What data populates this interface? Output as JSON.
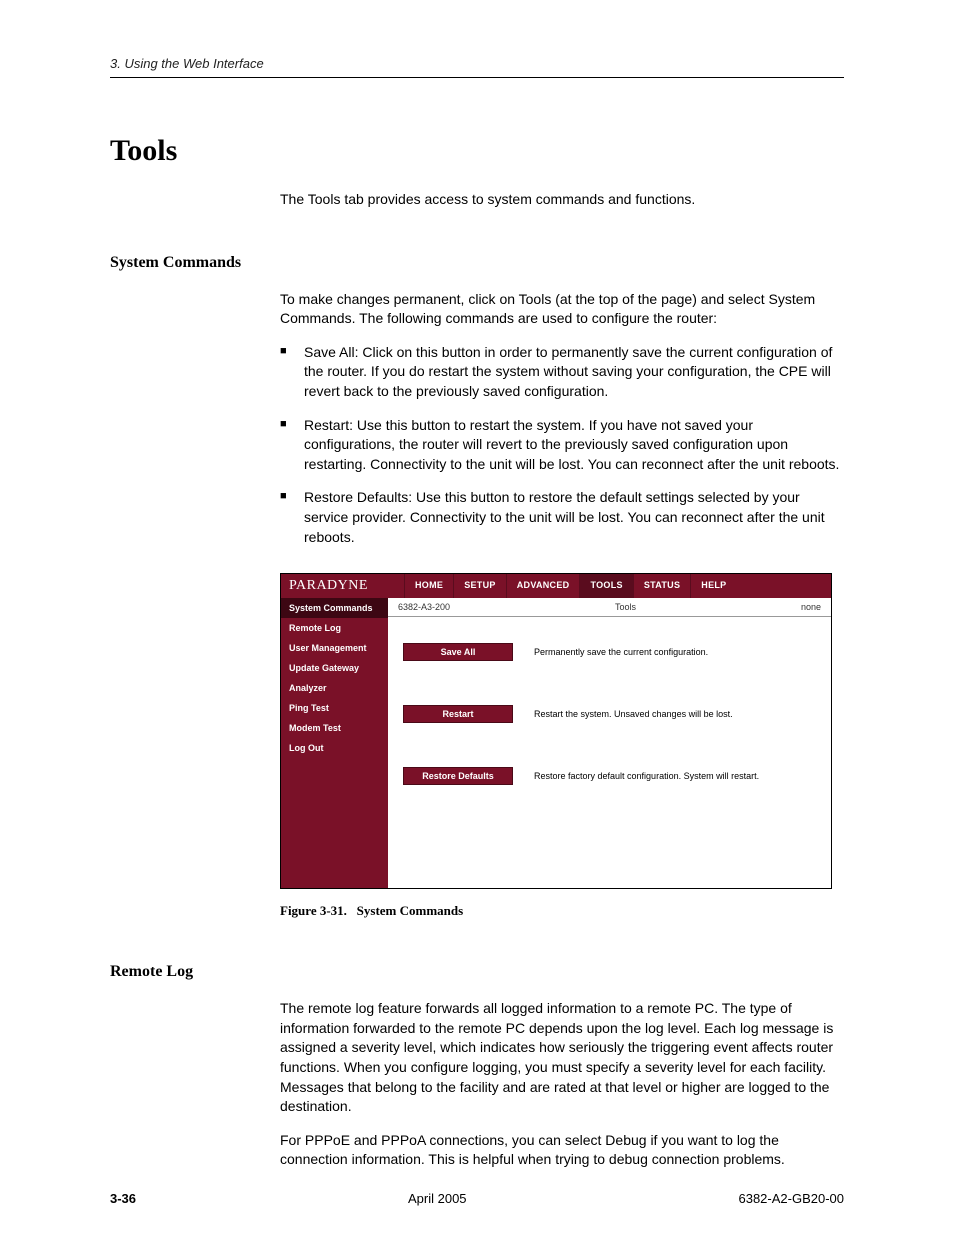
{
  "header": {
    "running": "3. Using the Web Interface"
  },
  "sections": {
    "tools": {
      "title": "Tools",
      "intro": "The Tools tab provides access to system commands and functions."
    },
    "syscmd": {
      "title": "System Commands",
      "p1": "To make changes permanent, click on Tools (at the top of the page) and select System Commands. The following commands are used to configure the router:",
      "bullets": [
        "Save All: Click on this button in order to permanently save the current configuration of the router. If you do restart the system without saving your configuration, the CPE will revert back to the previously saved configuration.",
        "Restart: Use this button to restart the system. If you have not saved your configurations, the router will revert to the previously saved configuration upon restarting. Connectivity to the unit will be lost. You can reconnect after the unit reboots.",
        "Restore Defaults: Use this button to restore the default settings selected by your service provider. Connectivity to the unit will be lost. You can reconnect after the unit reboots."
      ]
    },
    "remotelog": {
      "title": "Remote Log",
      "p1": "The remote log feature forwards all logged information to a remote PC. The type of information forwarded to the remote PC depends upon the log level. Each log message is assigned a severity level, which indicates how seriously the triggering event affects router functions. When you configure logging, you must specify a severity level for each facility. Messages that belong to the facility and are rated at that level or higher are logged to the destination.",
      "p2": "For PPPoE and PPPoA connections, you can select Debug if you want to log the connection information. This is helpful when trying to debug connection problems."
    }
  },
  "figure": {
    "logo": "PARADYNE",
    "tabs": [
      "HOME",
      "SETUP",
      "ADVANCED",
      "TOOLS",
      "STATUS",
      "HELP"
    ],
    "active_tab": "TOOLS",
    "sidebar": [
      "System Commands",
      "Remote Log",
      "User Management",
      "Update Gateway",
      "Analyzer",
      "Ping Test",
      "Modem Test",
      "Log Out"
    ],
    "active_side": "System Commands",
    "titlebar": {
      "left": "6382-A3-200",
      "mid": "Tools",
      "right": "none"
    },
    "rows": [
      {
        "btn": "Save All",
        "desc": "Permanently save the current configuration."
      },
      {
        "btn": "Restart",
        "desc": "Restart the system. Unsaved changes will be lost."
      },
      {
        "btn": "Restore Defaults",
        "desc": "Restore factory default configuration. System will restart."
      }
    ],
    "caption_num": "Figure 3-31.",
    "caption_txt": "System Commands"
  },
  "footer": {
    "page": "3-36",
    "date": "April 2005",
    "doc": "6382-A2-GB20-00"
  }
}
